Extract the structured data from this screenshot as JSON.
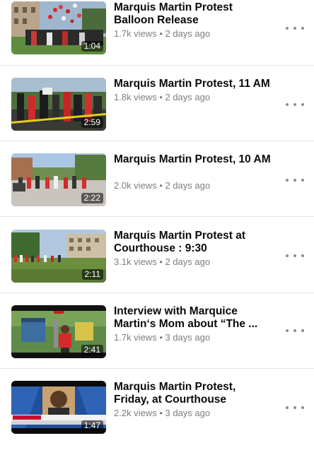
{
  "videos": [
    {
      "title": "Marquis Martin Protest Balloon Release",
      "views": "1.7k views",
      "age": "2 days ago",
      "duration": "1:04",
      "thumbnail_scene": "protest-crowd-balloons"
    },
    {
      "title": "Marquis Martin Protest, 11 AM",
      "views": "1.8k views",
      "age": "2 days ago",
      "duration": "2:59",
      "thumbnail_scene": "protest-crowd-signs"
    },
    {
      "title": "Marquis Martin Protest, 10 AM",
      "views": "2.0k views",
      "age": "2 days ago",
      "duration": "2:22",
      "thumbnail_scene": "street-crowd"
    },
    {
      "title": "Marquis Martin Protest at Courthouse : 9:30",
      "views": "3.1k views",
      "age": "2 days ago",
      "duration": "2:11",
      "thumbnail_scene": "courthouse-lawn"
    },
    {
      "title": "Interview with Marquice Martin‘s Mom about “The ...",
      "views": "1.7k views",
      "age": "3 days ago",
      "duration": "2:41",
      "thumbnail_scene": "news-interview-playground"
    },
    {
      "title": "Marquis Martin Protest, Friday, at Courthouse",
      "views": "2.2k views",
      "age": "3 days ago",
      "duration": "1:47",
      "thumbnail_scene": "news-broadcast-portrait"
    }
  ],
  "meta_separator": " • ",
  "colors": {
    "title": "#0a0a0a",
    "meta": "#7d7d7d",
    "divider": "#e6e6e6",
    "more_dots": "#8a8d91"
  }
}
